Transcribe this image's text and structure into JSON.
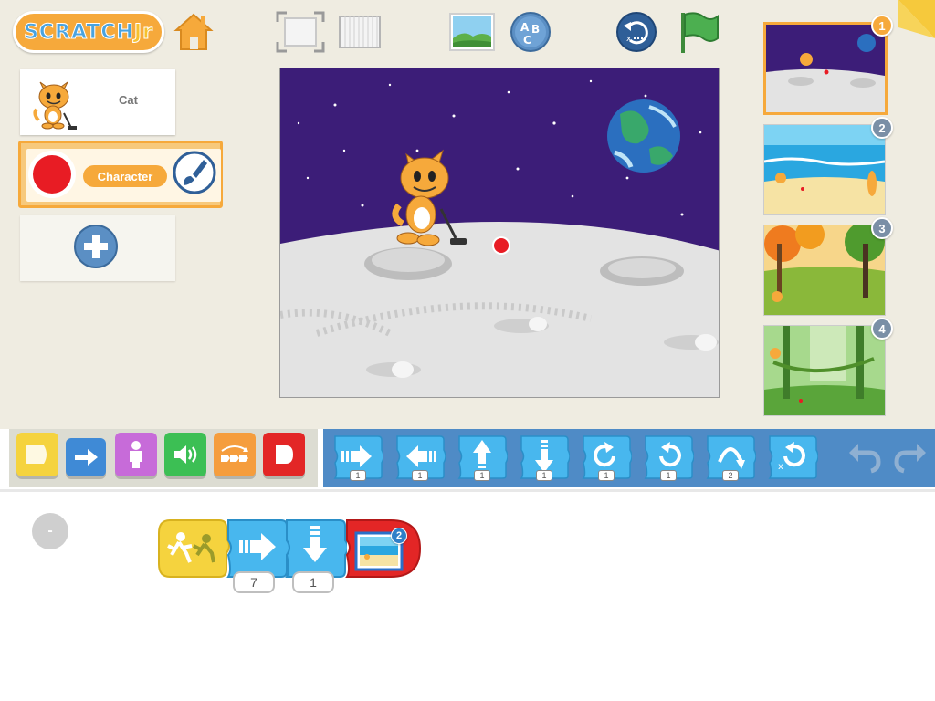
{
  "app": {
    "logo_text": "SCRATCH",
    "logo_suffix": "Jr"
  },
  "toolbar": {
    "home_icon": "home-icon",
    "fullscreen_icon": "fullscreen-icon",
    "grid_icon": "grid-icon",
    "background_icon": "background-picker-icon",
    "text_icon": "add-text-icon",
    "text_letters": "ABC",
    "reset_icon": "reset-characters-icon",
    "green_flag_icon": "green-flag-icon"
  },
  "sprites": {
    "items": [
      {
        "name": "Cat",
        "icon": "cat-sprite-icon"
      },
      {
        "name": "Character",
        "icon": "red-circle-sprite-icon"
      }
    ],
    "add_icon": "add-sprite-icon"
  },
  "pages": [
    {
      "number": "1",
      "scene": "moon"
    },
    {
      "number": "2",
      "scene": "beach"
    },
    {
      "number": "3",
      "scene": "autumn park"
    },
    {
      "number": "4",
      "scene": "jungle"
    }
  ],
  "palette": {
    "categories": [
      {
        "name": "triggering",
        "color": "#f5d33e",
        "icon": "trigger-category-icon"
      },
      {
        "name": "motion",
        "color": "#3f8ad6",
        "icon": "motion-category-icon"
      },
      {
        "name": "looks",
        "color": "#c76bd9",
        "icon": "looks-category-icon"
      },
      {
        "name": "sound",
        "color": "#3cbf54",
        "icon": "sound-category-icon"
      },
      {
        "name": "control",
        "color": "#f59d3d",
        "icon": "control-category-icon"
      },
      {
        "name": "end",
        "color": "#e32626",
        "icon": "end-category-icon"
      }
    ],
    "blocks": [
      {
        "icon": "move-right-icon",
        "value": "1"
      },
      {
        "icon": "move-left-icon",
        "value": "1"
      },
      {
        "icon": "move-up-icon",
        "value": "1"
      },
      {
        "icon": "move-down-icon",
        "value": "1"
      },
      {
        "icon": "turn-right-icon",
        "value": "1"
      },
      {
        "icon": "turn-left-icon",
        "value": "1"
      },
      {
        "icon": "hop-icon",
        "value": "2"
      },
      {
        "icon": "go-home-icon",
        "value": ""
      }
    ],
    "undo_icon": "undo-icon",
    "redo_icon": "redo-icon"
  },
  "script": {
    "blocks": [
      {
        "icon": "start-on-bump-icon"
      },
      {
        "icon": "move-right-icon",
        "value": "7"
      },
      {
        "icon": "move-down-icon",
        "value": "1"
      },
      {
        "icon": "go-to-page-icon",
        "page": "2"
      }
    ],
    "collapse_icon": "minimize-icon",
    "collapse_symbol": "-"
  },
  "colors": {
    "accent_orange": "#f6a93b",
    "palette_blue": "#4f8bc6",
    "block_blue": "#48b7ee",
    "stage_sky": "#3d1d7a",
    "badge_gray": "#7a8fa6"
  }
}
